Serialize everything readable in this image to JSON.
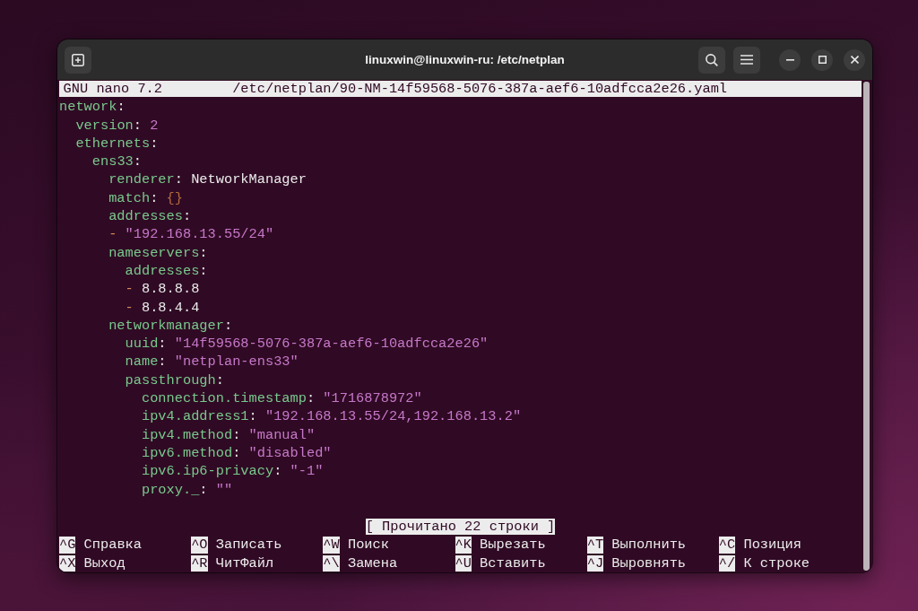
{
  "window": {
    "title": "linuxwin@linuxwin-ru: /etc/netplan"
  },
  "editor": {
    "app": "GNU nano 7.2",
    "file": "/etc/netplan/90-NM-14f59568-5076-387a-aef6-10adfcca2e26.yaml"
  },
  "lines": [
    {
      "tokens": [
        {
          "kind": "key",
          "text": "network"
        },
        {
          "kind": "colon",
          "text": ":"
        }
      ],
      "children": [
        {
          "tokens": [
            {
              "kind": "key",
              "text": "version"
            },
            {
              "kind": "colon",
              "text": ": "
            },
            {
              "kind": "number",
              "text": "2"
            }
          ]
        },
        {
          "tokens": [
            {
              "kind": "key",
              "text": "ethernets"
            },
            {
              "kind": "colon",
              "text": ":"
            }
          ],
          "children": [
            {
              "tokens": [
                {
                  "kind": "key",
                  "text": "ens33"
                },
                {
                  "kind": "colon",
                  "text": ":"
                }
              ],
              "children": [
                {
                  "tokens": [
                    {
                      "kind": "key",
                      "text": "renderer"
                    },
                    {
                      "kind": "colon",
                      "text": ": "
                    },
                    {
                      "kind": "plain",
                      "text": "NetworkManager"
                    }
                  ]
                },
                {
                  "tokens": [
                    {
                      "kind": "key",
                      "text": "match"
                    },
                    {
                      "kind": "colon",
                      "text": ": "
                    },
                    {
                      "kind": "brace",
                      "text": "{}"
                    }
                  ]
                },
                {
                  "tokens": [
                    {
                      "kind": "key",
                      "text": "addresses"
                    },
                    {
                      "kind": "colon",
                      "text": ":"
                    }
                  ]
                },
                {
                  "tokens": [
                    {
                      "kind": "dash",
                      "text": "- "
                    },
                    {
                      "kind": "string",
                      "text": "\"192.168.13.55/24\""
                    }
                  ]
                },
                {
                  "tokens": [
                    {
                      "kind": "key",
                      "text": "nameservers"
                    },
                    {
                      "kind": "colon",
                      "text": ":"
                    }
                  ],
                  "children": [
                    {
                      "tokens": [
                        {
                          "kind": "key",
                          "text": "addresses"
                        },
                        {
                          "kind": "colon",
                          "text": ":"
                        }
                      ]
                    },
                    {
                      "tokens": [
                        {
                          "kind": "dash",
                          "text": "- "
                        },
                        {
                          "kind": "plain",
                          "text": "8.8.8.8"
                        }
                      ]
                    },
                    {
                      "tokens": [
                        {
                          "kind": "dash",
                          "text": "- "
                        },
                        {
                          "kind": "plain",
                          "text": "8.8.4.4"
                        }
                      ]
                    }
                  ]
                },
                {
                  "tokens": [
                    {
                      "kind": "key",
                      "text": "networkmanager"
                    },
                    {
                      "kind": "colon",
                      "text": ":"
                    }
                  ],
                  "children": [
                    {
                      "tokens": [
                        {
                          "kind": "key",
                          "text": "uuid"
                        },
                        {
                          "kind": "colon",
                          "text": ": "
                        },
                        {
                          "kind": "string",
                          "text": "\"14f59568-5076-387a-aef6-10adfcca2e26\""
                        }
                      ]
                    },
                    {
                      "tokens": [
                        {
                          "kind": "key",
                          "text": "name"
                        },
                        {
                          "kind": "colon",
                          "text": ": "
                        },
                        {
                          "kind": "string",
                          "text": "\"netplan-ens33\""
                        }
                      ]
                    },
                    {
                      "tokens": [
                        {
                          "kind": "key",
                          "text": "passthrough"
                        },
                        {
                          "kind": "colon",
                          "text": ":"
                        }
                      ],
                      "children": [
                        {
                          "tokens": [
                            {
                              "kind": "key",
                              "text": "connection.timestamp"
                            },
                            {
                              "kind": "colon",
                              "text": ": "
                            },
                            {
                              "kind": "string",
                              "text": "\"1716878972\""
                            }
                          ]
                        },
                        {
                          "tokens": [
                            {
                              "kind": "key",
                              "text": "ipv4.address1"
                            },
                            {
                              "kind": "colon",
                              "text": ": "
                            },
                            {
                              "kind": "string",
                              "text": "\"192.168.13.55/24,192.168.13.2\""
                            }
                          ]
                        },
                        {
                          "tokens": [
                            {
                              "kind": "key",
                              "text": "ipv4.method"
                            },
                            {
                              "kind": "colon",
                              "text": ": "
                            },
                            {
                              "kind": "string",
                              "text": "\"manual\""
                            }
                          ]
                        },
                        {
                          "tokens": [
                            {
                              "kind": "key",
                              "text": "ipv6.method"
                            },
                            {
                              "kind": "colon",
                              "text": ": "
                            },
                            {
                              "kind": "string",
                              "text": "\"disabled\""
                            }
                          ]
                        },
                        {
                          "tokens": [
                            {
                              "kind": "key",
                              "text": "ipv6.ip6-privacy"
                            },
                            {
                              "kind": "colon",
                              "text": ": "
                            },
                            {
                              "kind": "string",
                              "text": "\"-1\""
                            }
                          ]
                        },
                        {
                          "tokens": [
                            {
                              "kind": "key",
                              "text": "proxy._"
                            },
                            {
                              "kind": "colon",
                              "text": ": "
                            },
                            {
                              "kind": "string",
                              "text": "\"\""
                            }
                          ]
                        }
                      ]
                    }
                  ]
                }
              ]
            }
          ]
        }
      ]
    }
  ],
  "status": "[ Прочитано 22 строки ]",
  "shortcut_rows": [
    {
      "items": [
        {
          "key": "^G",
          "label": "Справка"
        },
        {
          "key": "^O",
          "label": "Записать"
        },
        {
          "key": "^W",
          "label": "Поиск"
        },
        {
          "key": "^K",
          "label": "Вырезать"
        },
        {
          "key": "^T",
          "label": "Выполнить"
        },
        {
          "key": "^C",
          "label": "Позиция"
        }
      ]
    },
    {
      "items": [
        {
          "key": "^X",
          "label": "Выход"
        },
        {
          "key": "^R",
          "label": "ЧитФайл"
        },
        {
          "key": "^\\",
          "label": "Замена"
        },
        {
          "key": "^U",
          "label": "Вставить"
        },
        {
          "key": "^J",
          "label": "Выровнять"
        },
        {
          "key": "^/",
          "label": "К строке"
        }
      ]
    }
  ]
}
